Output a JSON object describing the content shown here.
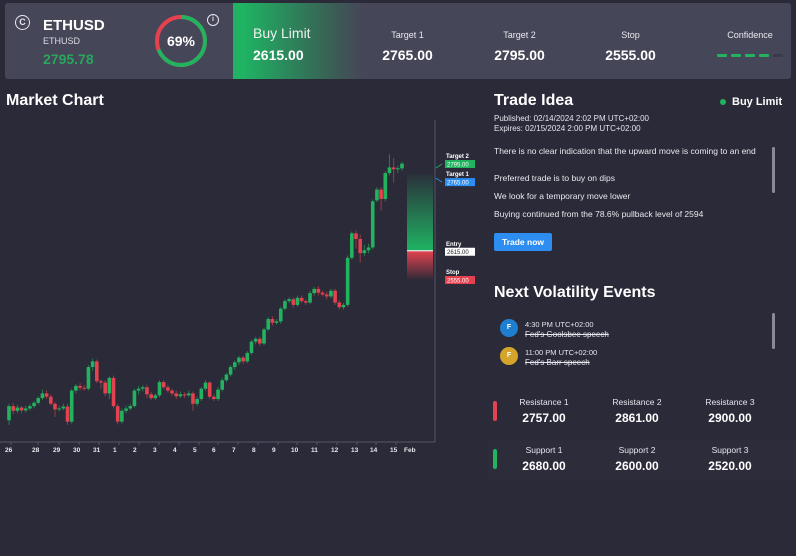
{
  "instrument": {
    "icon": "copyright-icon",
    "symbol": "ETHUSD",
    "subtitle": "ETHUSD",
    "price": "2795.78",
    "gauge_percent": 69,
    "gauge_label": "69%",
    "colors": {
      "up": "#22b35f",
      "down": "#e5424f"
    }
  },
  "order": {
    "type": "Buy Limit",
    "price": "2615.00"
  },
  "stats": [
    {
      "label": "Target 1",
      "value": "2765.00"
    },
    {
      "label": "Target 2",
      "value": "2795.00"
    },
    {
      "label": "Stop",
      "value": "2555.00"
    }
  ],
  "confidence": {
    "label": "Confidence",
    "level": 4,
    "max": 5
  },
  "market_chart": {
    "title": "Market Chart"
  },
  "chart_data": {
    "type": "candlestick",
    "title": "Market Chart",
    "xlabel": "",
    "ylabel": "",
    "x_tick_labels": [
      "26",
      "28",
      "29",
      "30",
      "31",
      "1",
      "2",
      "3",
      "4",
      "5",
      "6",
      "7",
      "8",
      "9",
      "10",
      "11",
      "12",
      "13",
      "14",
      "15",
      "Feb"
    ],
    "ylim": [
      2230,
      2840
    ],
    "levels": [
      {
        "name": "Target 2",
        "value": 2795.0,
        "label": "2795.00",
        "color": "#22b35f"
      },
      {
        "name": "Target 1",
        "value": 2765.0,
        "label": "2765.00",
        "color": "#2e8df0"
      },
      {
        "name": "Entry",
        "value": 2615.0,
        "label": "2615.00",
        "color": "#ffffff"
      },
      {
        "name": "Stop",
        "value": 2555.0,
        "label": "2555.00",
        "color": "#e5424f"
      }
    ],
    "candles": [
      [
        2255,
        2285,
        2245,
        2290
      ],
      [
        2285,
        2275,
        2268,
        2292
      ],
      [
        2275,
        2282,
        2270,
        2288
      ],
      [
        2282,
        2276,
        2270,
        2285
      ],
      [
        2276,
        2280,
        2272,
        2286
      ],
      [
        2280,
        2285,
        2276,
        2290
      ],
      [
        2285,
        2292,
        2280,
        2296
      ],
      [
        2292,
        2302,
        2288,
        2306
      ],
      [
        2302,
        2312,
        2298,
        2320
      ],
      [
        2312,
        2305,
        2300,
        2318
      ],
      [
        2305,
        2290,
        2286,
        2310
      ],
      [
        2290,
        2278,
        2262,
        2294
      ],
      [
        2278,
        2280,
        2274,
        2286
      ],
      [
        2280,
        2284,
        2276,
        2290
      ],
      [
        2284,
        2252,
        2245,
        2290
      ],
      [
        2252,
        2318,
        2248,
        2322
      ],
      [
        2318,
        2328,
        2312,
        2332
      ],
      [
        2328,
        2324,
        2318,
        2334
      ],
      [
        2324,
        2322,
        2318,
        2330
      ],
      [
        2322,
        2368,
        2318,
        2372
      ],
      [
        2368,
        2380,
        2360,
        2386
      ],
      [
        2380,
        2338,
        2334,
        2384
      ],
      [
        2338,
        2335,
        2322,
        2342
      ],
      [
        2335,
        2312,
        2306,
        2340
      ],
      [
        2312,
        2345,
        2300,
        2348
      ],
      [
        2345,
        2285,
        2280,
        2350
      ],
      [
        2285,
        2252,
        2246,
        2290
      ],
      [
        2252,
        2275,
        2248,
        2280
      ],
      [
        2275,
        2280,
        2270,
        2286
      ],
      [
        2280,
        2285,
        2276,
        2290
      ],
      [
        2285,
        2318,
        2282,
        2322
      ],
      [
        2318,
        2322,
        2310,
        2328
      ],
      [
        2322,
        2325,
        2316,
        2330
      ],
      [
        2325,
        2310,
        2302,
        2330
      ],
      [
        2310,
        2302,
        2298,
        2315
      ],
      [
        2302,
        2308,
        2298,
        2312
      ],
      [
        2308,
        2336,
        2304,
        2340
      ],
      [
        2336,
        2325,
        2320,
        2340
      ],
      [
        2325,
        2318,
        2314,
        2330
      ],
      [
        2318,
        2312,
        2308,
        2322
      ],
      [
        2312,
        2306,
        2300,
        2318
      ],
      [
        2306,
        2310,
        2302,
        2316
      ],
      [
        2310,
        2308,
        2302,
        2314
      ],
      [
        2308,
        2312,
        2304,
        2318
      ],
      [
        2312,
        2290,
        2275,
        2316
      ],
      [
        2290,
        2300,
        2285,
        2305
      ],
      [
        2300,
        2322,
        2296,
        2326
      ],
      [
        2322,
        2335,
        2318,
        2340
      ],
      [
        2335,
        2305,
        2300,
        2338
      ],
      [
        2305,
        2300,
        2296,
        2310
      ],
      [
        2300,
        2320,
        2296,
        2326
      ],
      [
        2320,
        2340,
        2316,
        2345
      ],
      [
        2340,
        2352,
        2336,
        2356
      ],
      [
        2352,
        2368,
        2348,
        2372
      ],
      [
        2368,
        2378,
        2362,
        2382
      ],
      [
        2378,
        2388,
        2372,
        2392
      ],
      [
        2388,
        2380,
        2374,
        2392
      ],
      [
        2380,
        2398,
        2376,
        2402
      ],
      [
        2398,
        2422,
        2394,
        2426
      ],
      [
        2422,
        2428,
        2416,
        2432
      ],
      [
        2428,
        2418,
        2412,
        2432
      ],
      [
        2418,
        2448,
        2414,
        2452
      ],
      [
        2448,
        2470,
        2444,
        2474
      ],
      [
        2470,
        2462,
        2456,
        2476
      ],
      [
        2462,
        2465,
        2458,
        2470
      ],
      [
        2465,
        2492,
        2460,
        2496
      ],
      [
        2492,
        2508,
        2488,
        2512
      ],
      [
        2508,
        2512,
        2504,
        2516
      ],
      [
        2512,
        2500,
        2494,
        2516
      ],
      [
        2500,
        2515,
        2496,
        2520
      ],
      [
        2515,
        2508,
        2504,
        2520
      ],
      [
        2508,
        2505,
        2500,
        2512
      ],
      [
        2505,
        2525,
        2502,
        2530
      ],
      [
        2525,
        2534,
        2520,
        2538
      ],
      [
        2534,
        2526,
        2520,
        2540
      ],
      [
        2526,
        2522,
        2518,
        2530
      ],
      [
        2522,
        2518,
        2512,
        2528
      ],
      [
        2518,
        2530,
        2514,
        2534
      ],
      [
        2530,
        2505,
        2500,
        2534
      ],
      [
        2505,
        2495,
        2490,
        2510
      ],
      [
        2495,
        2500,
        2490,
        2504
      ],
      [
        2500,
        2600,
        2496,
        2605
      ],
      [
        2600,
        2652,
        2596,
        2656
      ],
      [
        2652,
        2640,
        2620,
        2658
      ],
      [
        2640,
        2610,
        2590,
        2650
      ],
      [
        2610,
        2616,
        2604,
        2628
      ],
      [
        2616,
        2622,
        2610,
        2630
      ],
      [
        2622,
        2720,
        2618,
        2724
      ],
      [
        2722,
        2745,
        2718,
        2750
      ],
      [
        2745,
        2725,
        2700,
        2750
      ],
      [
        2725,
        2780,
        2720,
        2784
      ],
      [
        2780,
        2792,
        2775,
        2820
      ],
      [
        2792,
        2788,
        2760,
        2812
      ],
      [
        2788,
        2790,
        2780,
        2796
      ],
      [
        2790,
        2800,
        2785,
        2804
      ]
    ]
  },
  "trade_idea": {
    "title": "Trade Idea",
    "badge": "Buy Limit",
    "published": "Published:  02/14/2024 2:02 PM UTC+02:00",
    "expires": "Expires:  02/15/2024 2:00 PM UTC+02:00",
    "points": [
      "There is no clear indication that the upward move is coming to an end",
      "Preferred trade is to buy on dips",
      "We look for a temporary move lower",
      "Buying continued from the 78.6% pullback level of 2594"
    ],
    "button": "Trade now"
  },
  "volatility": {
    "title": "Next Volatility Events",
    "events": [
      {
        "avatar": "F",
        "color": "#1e7fd0",
        "time": "4:30 PM UTC+02:00",
        "name": "Fed's Goolsbee speech"
      },
      {
        "avatar": "F",
        "color": "#d4a52a",
        "time": "11:00 PM UTC+02:00",
        "name": "Fed's Barr speech"
      }
    ]
  },
  "levels": {
    "resistance": [
      {
        "label": "Resistance 1",
        "value": "2757.00"
      },
      {
        "label": "Resistance 2",
        "value": "2861.00"
      },
      {
        "label": "Resistance 3",
        "value": "2900.00"
      }
    ],
    "support": [
      {
        "label": "Support 1",
        "value": "2680.00"
      },
      {
        "label": "Support 2",
        "value": "2600.00"
      },
      {
        "label": "Support 3",
        "value": "2520.00"
      }
    ]
  }
}
